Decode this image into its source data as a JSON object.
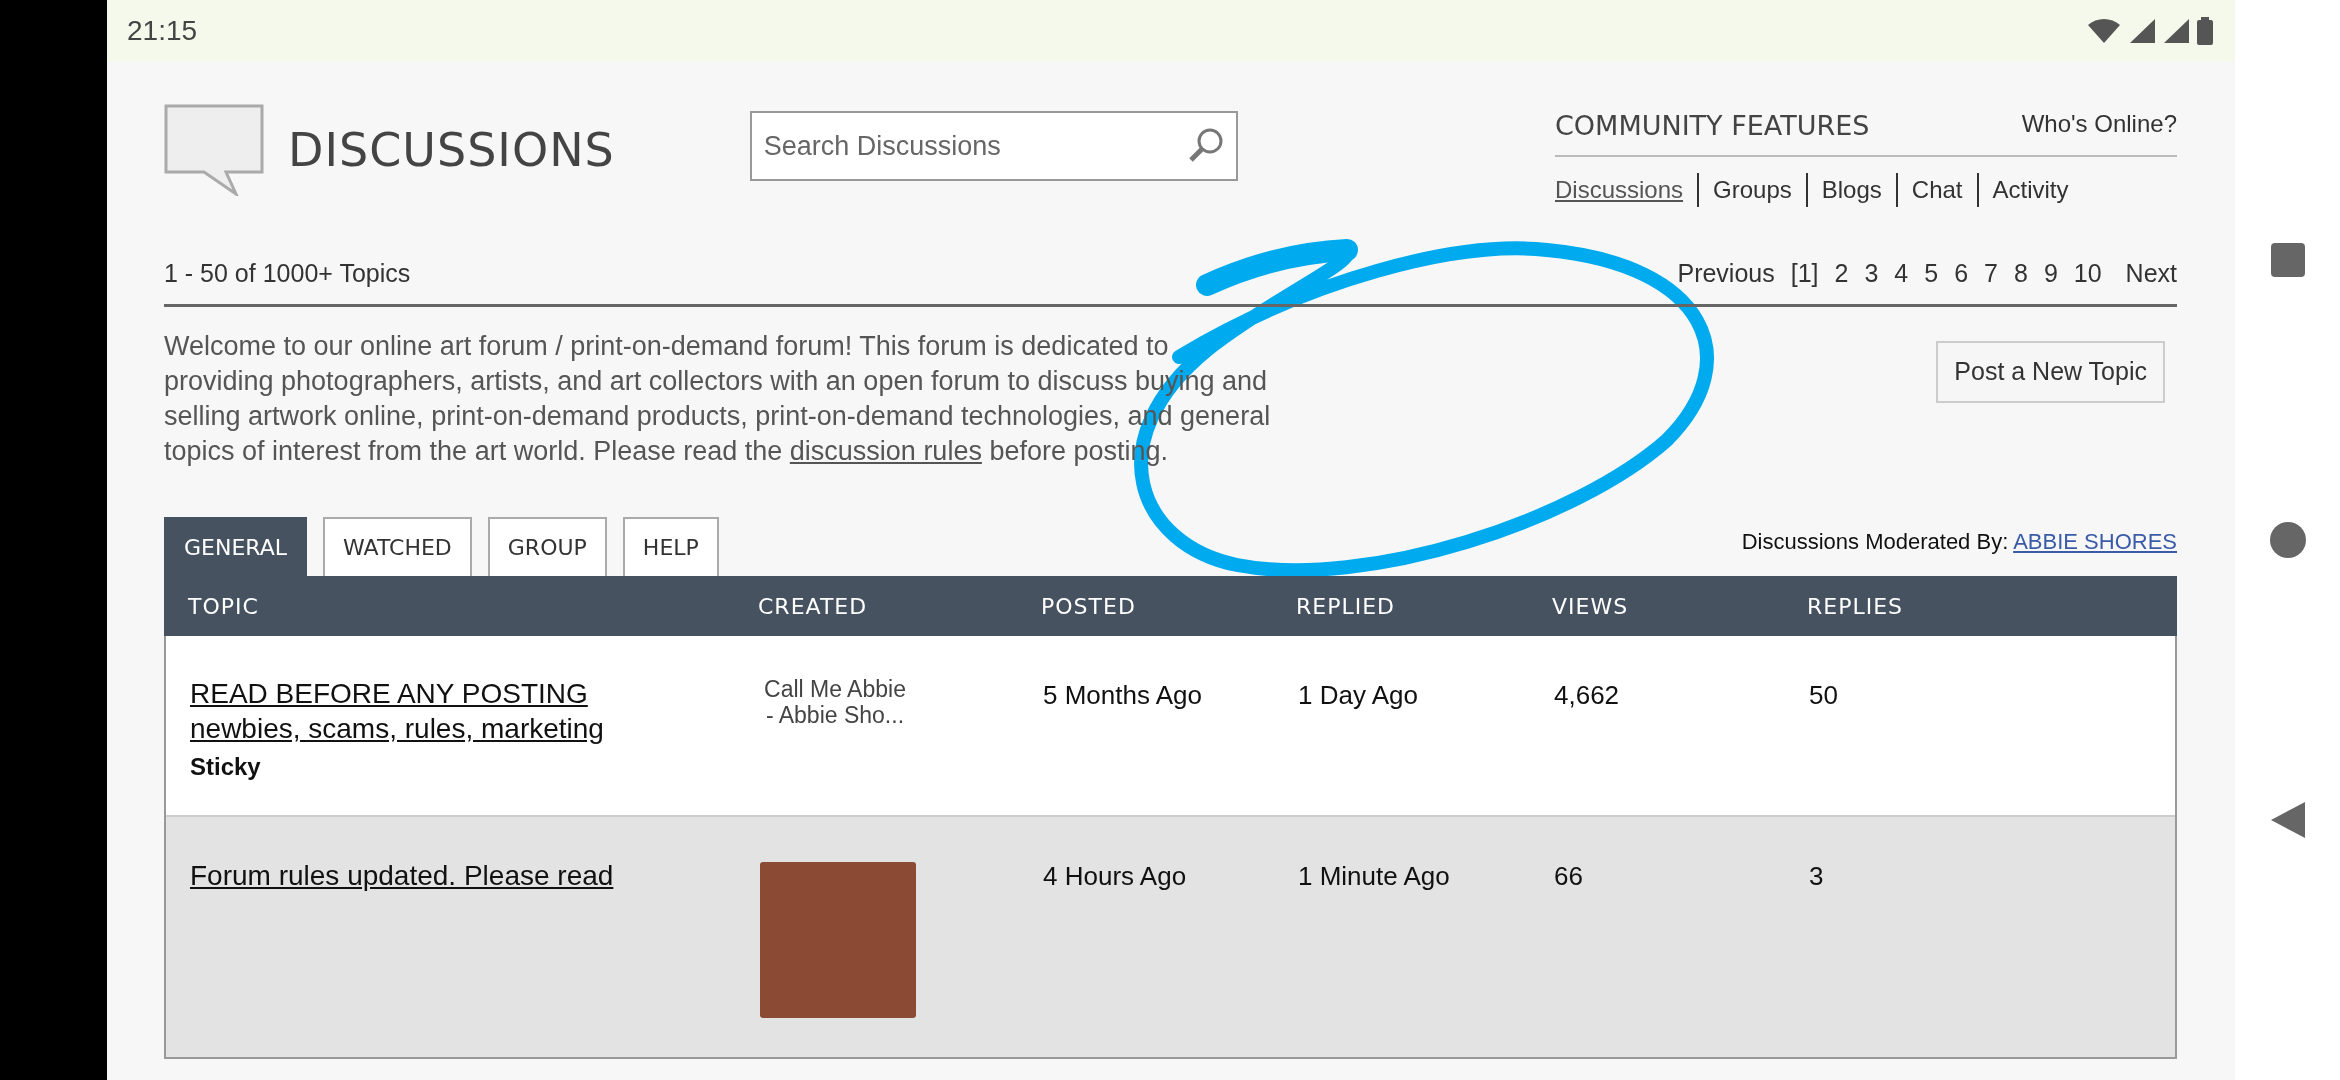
{
  "status_bar": {
    "time": "21:15"
  },
  "header": {
    "title": "DISCUSSIONS",
    "search": {
      "placeholder": "Search Discussions"
    },
    "community": {
      "title": "COMMUNITY FEATURES",
      "whos_online": "Who's Online?",
      "links": [
        {
          "label": "Discussions",
          "selected": true
        },
        {
          "label": "Groups",
          "selected": false
        },
        {
          "label": "Blogs",
          "selected": false
        },
        {
          "label": "Chat",
          "selected": false
        },
        {
          "label": "Activity",
          "selected": false
        }
      ]
    }
  },
  "topic_count": "1 - 50 of 1000+ Topics",
  "pagination": {
    "previous": "Previous",
    "pages": [
      "[1]",
      "2",
      "3",
      "4",
      "5",
      "6",
      "7",
      "8",
      "9",
      "10"
    ],
    "next": "Next"
  },
  "intro": {
    "text_before": "Welcome to our online art forum / print-on-demand forum!  This forum is dedicated to providing photographers, artists, and art collectors with an open forum to discuss buying and selling artwork online, print-on-demand products, print-on-demand technologies, and general topics of interest from the art world.   Please read the",
    "link": "discussion rules",
    "text_after": "before posting."
  },
  "post_button": "Post a New Topic",
  "tabs": [
    {
      "label": "GENERAL",
      "selected": true
    },
    {
      "label": "WATCHED",
      "selected": false
    },
    {
      "label": "GROUP",
      "selected": false
    },
    {
      "label": "HELP",
      "selected": false
    }
  ],
  "moderated": {
    "label": "Discussions Moderated By:",
    "moderator": "ABBIE SHORES"
  },
  "table": {
    "columns": [
      "TOPIC",
      "CREATED",
      "POSTED",
      "REPLIED",
      "VIEWS",
      "REPLIES"
    ],
    "rows": [
      {
        "highlighted": false,
        "title_lines": [
          "READ BEFORE ANY POSTING",
          "newbies, scams, rules, marketing"
        ],
        "tag": "Sticky",
        "created": {
          "kind": "text",
          "lines": [
            "Call Me Abbie",
            "- Abbie Sho..."
          ]
        },
        "posted": "5 Months Ago",
        "replied": "1 Day Ago",
        "views": "4,662",
        "replies": "50"
      },
      {
        "highlighted": true,
        "title_lines": [
          "Forum rules updated. Please read"
        ],
        "created": {
          "kind": "avatar"
        },
        "posted": "4 Hours Ago",
        "replied": "1 Minute Ago",
        "views": "66",
        "replies": "3"
      }
    ]
  }
}
